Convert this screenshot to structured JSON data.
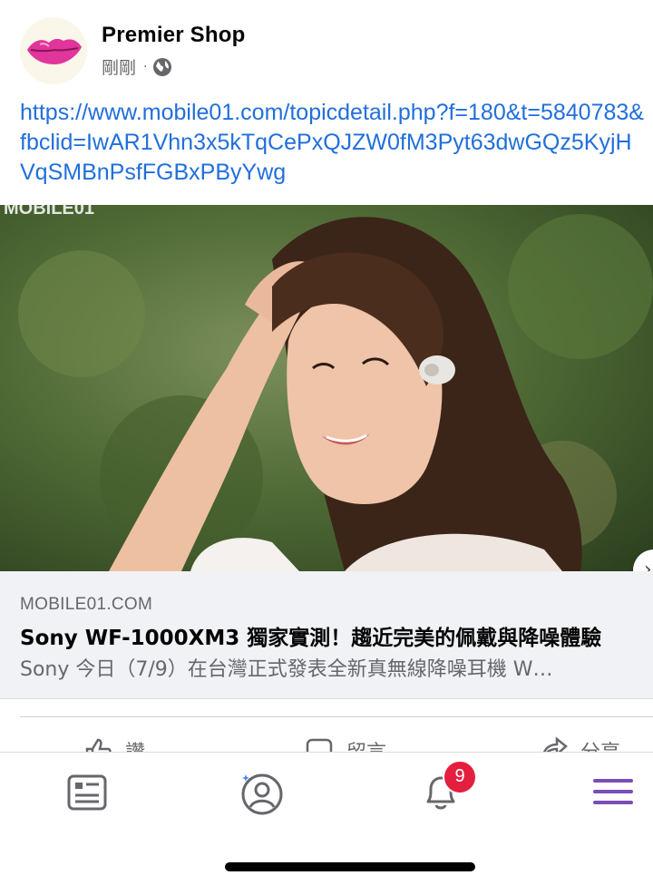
{
  "post": {
    "author": "Premier Shop",
    "timestamp": "剛剛",
    "separator": "·",
    "privacy_icon": "globe-icon",
    "link_text": "https://www.mobile01.com/topicdetail.php?f=180&t=5840783&fbclid=IwAR1Vhn3x5kTqCePxQJZW0fM3Pyt63dwGQz5KyjHVqSMBnPsfFGBxPByYwg"
  },
  "link_preview": {
    "watermark": "MOBILE01",
    "domain": "MOBILE01.COM",
    "title": "Sony WF-1000XM3 獨家實測！趨近完美的佩戴與降噪體驗",
    "description": "Sony 今日（7/9）在台灣正式發表全新真無線降噪耳機 W…"
  },
  "actions": [
    {
      "label": "讚",
      "icon": "like-icon"
    },
    {
      "label": "留言",
      "icon": "comment-icon"
    },
    {
      "label": "分享",
      "icon": "share-icon"
    }
  ],
  "bottom_nav": {
    "items": [
      {
        "name": "news-feed",
        "icon": "news-feed-icon"
      },
      {
        "name": "profile",
        "icon": "profile-icon"
      },
      {
        "name": "notifications",
        "icon": "bell-icon"
      },
      {
        "name": "menu",
        "icon": "menu-icon"
      }
    ],
    "notification_count": "9"
  },
  "colors": {
    "link": "#216fdb",
    "badge": "#e41e3f",
    "menu_accent": "#7b4db8",
    "secondary_text": "#65676b",
    "preview_background": "#f0f2f5"
  }
}
